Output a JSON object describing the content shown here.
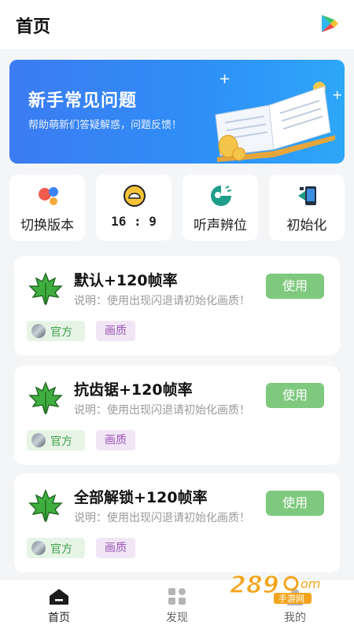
{
  "header": {
    "title": "首页",
    "play_icon": "play-store-icon"
  },
  "banner": {
    "title": "新手常见问题",
    "subtitle": "帮助萌新们答疑解惑，问题反馈！",
    "illustration": "open-book-illustration"
  },
  "quick_actions": [
    {
      "label": "切换版本",
      "icon": "switch-version-icon"
    },
    {
      "label": "16 : 9",
      "icon": "aspect-ratio-icon"
    },
    {
      "label": "听声辨位",
      "icon": "sound-locate-icon"
    },
    {
      "label": "初始化",
      "icon": "reset-icon"
    }
  ],
  "configs": [
    {
      "title": "默认+120帧率",
      "description": "说明：使用出现闪退请初始化画质！",
      "button": "使用",
      "tag_official": "官方",
      "tag_category": "画质"
    },
    {
      "title": "抗齿锯+120帧率",
      "description": "说明：使用出现闪退请初始化画质！",
      "button": "使用",
      "tag_official": "官方",
      "tag_category": "画质"
    },
    {
      "title": "全部解锁+120帧率",
      "description": "说明：使用出现闪退请初始化画质！",
      "button": "使用",
      "tag_official": "官方",
      "tag_category": "画质"
    }
  ],
  "tabs": [
    {
      "label": "首页",
      "icon": "home-icon",
      "active": true
    },
    {
      "label": "发现",
      "icon": "discover-grid-icon",
      "active": false
    },
    {
      "label": "我的",
      "icon": "profile-icon",
      "active": false
    }
  ],
  "watermark": {
    "brand": "289",
    "domain_suffix": "com",
    "caption": "手游网"
  },
  "colors": {
    "accent_blue": "#2f8ef7",
    "use_button": "#7fc97f",
    "tag_official_text": "#3f9f4a",
    "tag_quality_text": "#9b58b5"
  }
}
